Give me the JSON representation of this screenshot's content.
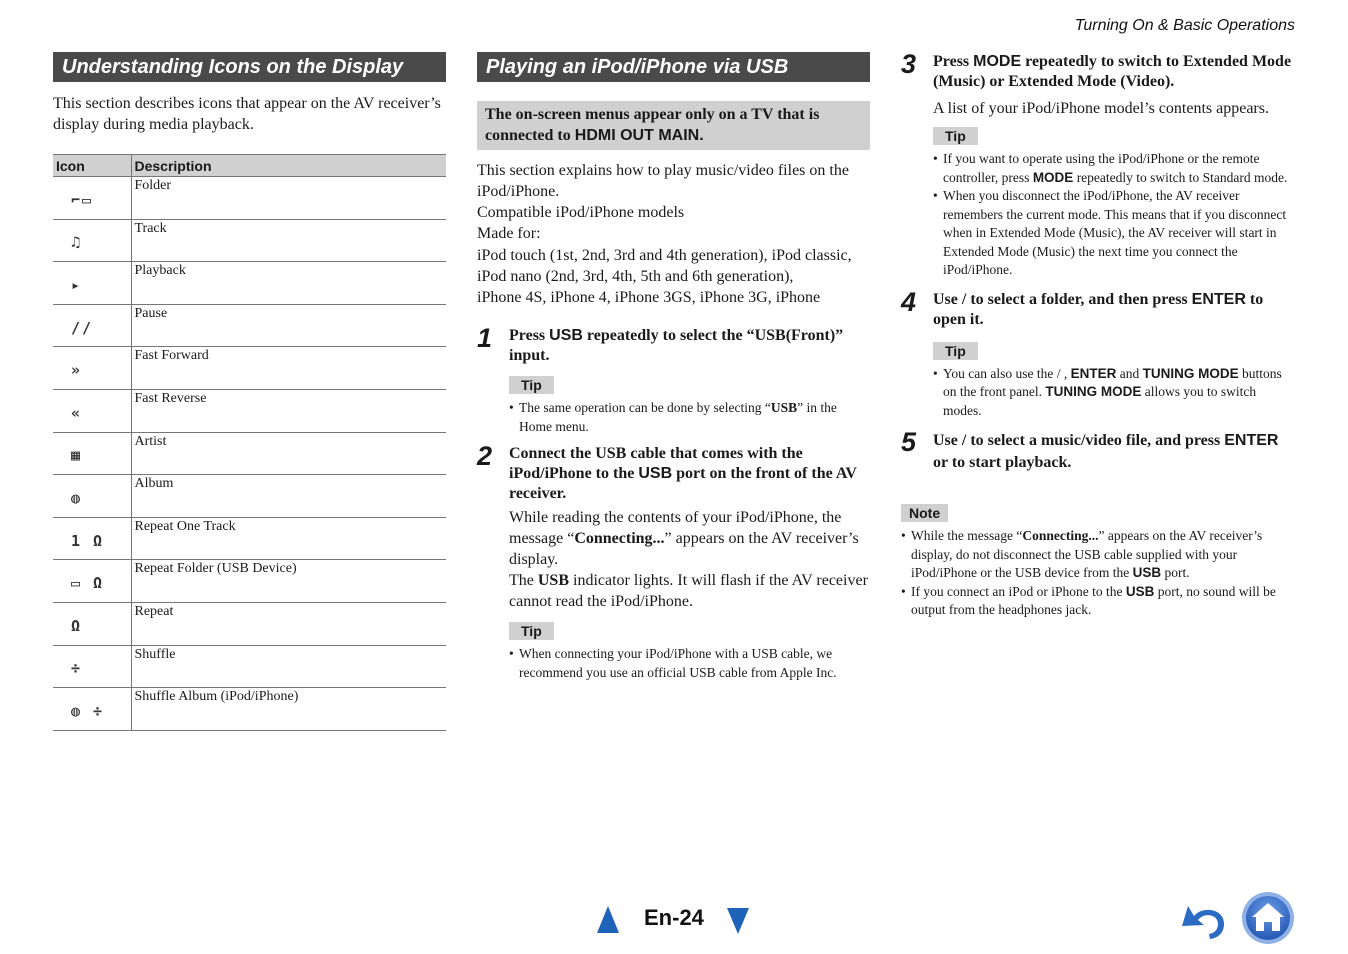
{
  "running_head": "Turning On & Basic Operations",
  "left": {
    "title": "Understanding Icons on the Display",
    "intro": "This section describes icons that appear on the AV receiver’s display during media playback.",
    "table": {
      "headers": [
        "Icon",
        "Description"
      ],
      "rows": [
        {
          "icon": "folder-icon",
          "glyph": "⌐▭",
          "description": "Folder"
        },
        {
          "icon": "track-icon",
          "glyph": "♫",
          "description": "Track"
        },
        {
          "icon": "playback-icon",
          "glyph": "▸",
          "description": "Playback"
        },
        {
          "icon": "pause-icon",
          "glyph": "//",
          "description": "Pause"
        },
        {
          "icon": "fast-forward-icon",
          "glyph": "»",
          "description": "Fast Forward"
        },
        {
          "icon": "fast-reverse-icon",
          "glyph": "«",
          "description": "Fast Reverse"
        },
        {
          "icon": "artist-icon",
          "glyph": "▦",
          "description": "Artist"
        },
        {
          "icon": "album-icon",
          "glyph": "◍",
          "description": "Album"
        },
        {
          "icon": "repeat-one-track-icon",
          "glyph": "1 Ω",
          "description": "Repeat One Track"
        },
        {
          "icon": "repeat-folder-icon",
          "glyph": "▭ Ω",
          "description": "Repeat Folder (USB Device)"
        },
        {
          "icon": "repeat-icon",
          "glyph": "Ω",
          "description": "Repeat"
        },
        {
          "icon": "shuffle-icon",
          "glyph": "÷",
          "description": "Shuffle"
        },
        {
          "icon": "shuffle-album-icon",
          "glyph": "◍ ÷",
          "description": "Shuffle Album (iPod/iPhone)"
        }
      ]
    }
  },
  "middle": {
    "title": "Playing an iPod/iPhone via USB",
    "notice_line1": "The on-screen menus appear only on a TV that is",
    "notice_line2_prefix": "connected to ",
    "notice_line2_kw": "HDMI OUT MAIN.",
    "para1": "This section explains how to play music/video files on the iPod/iPhone.",
    "para2": "Compatible iPod/iPhone models",
    "para3": "Made for:",
    "para4": "iPod touch (1st, 2nd, 3rd and 4th generation), iPod classic, iPod nano (2nd, 3rd, 4th, 5th and 6th generation),",
    "para4b": "iPhone 4S, iPhone 4, iPhone 3GS, iPhone 3G, iPhone",
    "step1": {
      "num": "1",
      "t1": "Press ",
      "kw": "USB",
      "t2": " repeatedly to select the “USB(Front)” input.",
      "tip_label": "Tip",
      "tip_a": "The same operation can be done by selecting “",
      "tip_kw": "USB",
      "tip_b": "” in the Home menu."
    },
    "step2": {
      "num": "2",
      "t1": "Connect the USB cable that comes with the iPod/iPhone to the ",
      "kw": "USB",
      "t2": " port on the front of the AV receiver.",
      "p1a": "While reading the contents of your iPod/iPhone, the message “",
      "p1kw": "Connecting...",
      "p1b": "” appears on the AV receiver’s display.",
      "p2a": "The ",
      "p2kw": "USB",
      "p2b": " indicator lights. It will flash if the AV receiver cannot read the iPod/iPhone.",
      "tip_label": "Tip",
      "tip": "When connecting your iPod/iPhone with a USB cable, we recommend you use an official USB cable from Apple Inc."
    }
  },
  "right": {
    "step3": {
      "num": "3",
      "t1": "Press ",
      "kw": "MODE",
      "t2": " repeatedly to switch to Extended Mode (Music) or Extended Mode (Video).",
      "body": "A list of your iPod/iPhone model’s contents appears.",
      "tip_label": "Tip",
      "tip1a": "If you want to operate using the iPod/iPhone or the remote controller, press ",
      "tip1kw": "MODE",
      "tip1b": " repeatedly to switch to Standard mode.",
      "tip2": "When you disconnect the iPod/iPhone, the AV receiver remembers the current mode. This means that if you disconnect when in Extended Mode (Music), the AV receiver will start in Extended Mode (Music) the next time you connect the iPod/iPhone."
    },
    "step4": {
      "num": "4",
      "t1": "Use  /  to select a folder, and then press ",
      "kw": "ENTER",
      "t2": " to open it.",
      "tip_label": "Tip",
      "tip_a": "You can also use the  /  , ",
      "tip_kw1": "ENTER",
      "tip_b": " and ",
      "tip_kw2": "TUNING MODE",
      "tip_c": " buttons on the front panel. ",
      "tip_kw3": "TUNING MODE",
      "tip_d": " allows you to switch modes."
    },
    "step5": {
      "num": "5",
      "t1": "Use  /  to select a music/video file, and press ",
      "kw": "ENTER",
      "t2": " or       to start playback."
    },
    "note": {
      "label": "Note",
      "n1a": "While the message “",
      "n1kw": "Connecting...",
      "n1b": "” appears on the AV receiver’s display, do not disconnect the USB cable supplied with your iPod/iPhone or the USB device from the ",
      "n1kw2": "USB",
      "n1c": " port.",
      "n2a": "If you connect an iPod or iPhone to the ",
      "n2kw": "USB",
      "n2b": " port, no sound will be output from the headphones jack."
    }
  },
  "footer": {
    "page": "En-24",
    "accent": "#1e63b8"
  }
}
